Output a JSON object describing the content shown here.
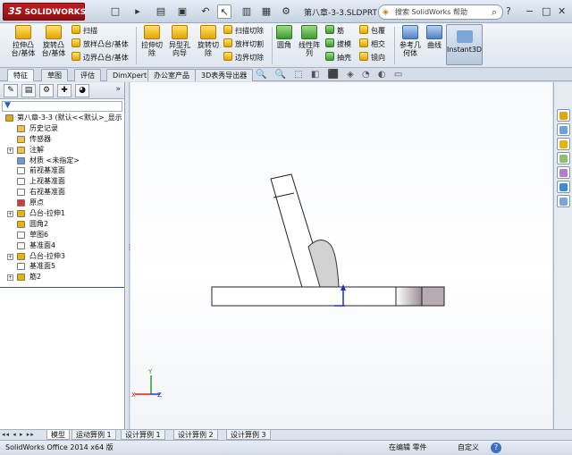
{
  "app": {
    "logo_text": "SOLIDWORKS",
    "logo_mark": "3S",
    "document_title": "第八章-3-3.SLDPRT",
    "search_placeholder": "搜索 SolidWorks 帮助",
    "help_glyph": "?",
    "window_controls": [
      "−",
      "□",
      "✕"
    ],
    "quick_access": [
      "□",
      "▸",
      "▤",
      "▣",
      "↶",
      "↖",
      "▥",
      "▦",
      "⚙"
    ]
  },
  "ribbon": {
    "features_group1": [
      {
        "label": "拉伸凸\n台/基体",
        "icon": "extrude-boss-icon"
      },
      {
        "label": "旋转凸\n台/基体",
        "icon": "revolve-boss-icon"
      }
    ],
    "features_group1_small": [
      {
        "label": "扫描",
        "icon": "sweep-icon"
      },
      {
        "label": "放样凸台/基体",
        "icon": "loft-icon"
      },
      {
        "label": "边界凸台/基体",
        "icon": "boundary-boss-icon"
      }
    ],
    "features_group2": [
      {
        "label": "拉伸切\n除",
        "icon": "extrude-cut-icon"
      },
      {
        "label": "异型孔\n向导",
        "icon": "hole-wizard-icon"
      },
      {
        "label": "旋转切\n除",
        "icon": "revolve-cut-icon"
      }
    ],
    "features_group2_small": [
      {
        "label": "扫描切除",
        "icon": "swept-cut-icon"
      },
      {
        "label": "放样切割",
        "icon": "lofted-cut-icon"
      },
      {
        "label": "边界切除",
        "icon": "boundary-cut-icon"
      }
    ],
    "features_group3": [
      {
        "label": "圆角",
        "icon": "fillet-icon"
      },
      {
        "label": "线性阵\n列",
        "icon": "linear-pattern-icon"
      }
    ],
    "features_group3_small": [
      {
        "label": "筋",
        "icon": "rib-icon"
      },
      {
        "label": "拔模",
        "icon": "draft-icon"
      },
      {
        "label": "抽壳",
        "icon": "shell-icon"
      },
      {
        "label": "包覆",
        "icon": "wrap-icon"
      },
      {
        "label": "相交",
        "icon": "intersect-icon"
      },
      {
        "label": "镜向",
        "icon": "mirror-icon"
      }
    ],
    "features_group4": [
      {
        "label": "参考几\n何体",
        "icon": "reference-geometry-icon"
      },
      {
        "label": "曲线",
        "icon": "curves-icon"
      }
    ],
    "instant3d": "Instant3D"
  },
  "tabs": [
    {
      "label": "特征",
      "active": true
    },
    {
      "label": "草图",
      "active": false
    },
    {
      "label": "评估",
      "active": false
    },
    {
      "label": "DimXpert",
      "active": false
    },
    {
      "label": "办公室产品",
      "active": false
    },
    {
      "label": "3D表秀导出器",
      "active": false
    }
  ],
  "heads_up_toolbar": "🔍 🔍 ⬚ ◧ ⬛ ◈ ◔ ◐ ▭",
  "panel": {
    "more_glyph": "»",
    "tab_glyphs": [
      "✎",
      "▤",
      "⚙",
      "✚",
      "◕"
    ],
    "filter_glyph": "▼"
  },
  "feature_tree": [
    {
      "label": "第八章-3-3  (默认<<默认>_显示",
      "icon": "part-icon",
      "color": "#e0a800",
      "root": true,
      "expander": ""
    },
    {
      "label": "历史记录",
      "icon": "history-icon",
      "color": "#f0c24a",
      "expander": ""
    },
    {
      "label": "传感器",
      "icon": "sensors-icon",
      "color": "#f0c24a",
      "expander": ""
    },
    {
      "label": "注解",
      "icon": "annotations-icon",
      "color": "#f0c24a",
      "expander": "+"
    },
    {
      "label": "材质 <未指定>",
      "icon": "material-icon",
      "color": "#6a9ad6",
      "expander": ""
    },
    {
      "label": "前视基准面",
      "icon": "plane-icon",
      "color": "#ffffff",
      "expander": ""
    },
    {
      "label": "上视基准面",
      "icon": "plane-icon",
      "color": "#ffffff",
      "expander": ""
    },
    {
      "label": "右视基准面",
      "icon": "plane-icon",
      "color": "#ffffff",
      "expander": ""
    },
    {
      "label": "原点",
      "icon": "origin-icon",
      "color": "#d23a3a",
      "expander": ""
    },
    {
      "label": "凸台-拉伸1",
      "icon": "extrude-feature-icon",
      "color": "#e8b400",
      "expander": "+"
    },
    {
      "label": "圆角2",
      "icon": "fillet-feature-icon",
      "color": "#e8b400",
      "expander": ""
    },
    {
      "label": "草图6",
      "icon": "sketch-icon",
      "color": "#ffffff",
      "expander": ""
    },
    {
      "label": "基准面4",
      "icon": "plane-icon",
      "color": "#ffffff",
      "expander": ""
    },
    {
      "label": "凸台-拉伸3",
      "icon": "extrude-feature-icon",
      "color": "#e8b400",
      "expander": "+"
    },
    {
      "label": "基准面5",
      "icon": "plane-icon",
      "color": "#ffffff",
      "expander": ""
    },
    {
      "label": "筋2",
      "icon": "rib-feature-icon",
      "color": "#e8b400",
      "expander": "+"
    }
  ],
  "triad": {
    "x": "X",
    "y": "Y",
    "z": "Z"
  },
  "task_pane": [
    {
      "icon": "solidworks-resources-icon",
      "color": "#e0a800"
    },
    {
      "icon": "design-library-icon",
      "color": "#6aa3dc"
    },
    {
      "icon": "file-explorer-icon",
      "color": "#e5b400"
    },
    {
      "icon": "search-view-icon",
      "color": "#8fbf6a"
    },
    {
      "icon": "view-palette-icon",
      "color": "#b07bd0"
    },
    {
      "icon": "appearances-icon",
      "color": "#3a8ad6"
    },
    {
      "icon": "custom-properties-icon",
      "color": "#7ba7d8"
    }
  ],
  "bottom_tabs": {
    "nav": "◂◂ ◂ ▸ ▸▸",
    "items": [
      {
        "label": "模型",
        "active": true
      },
      {
        "label": "运动算例 1",
        "active": false
      },
      {
        "label": "设计算例 1",
        "active": false
      },
      {
        "label": "设计算例 2",
        "active": false
      },
      {
        "label": "设计算例 3",
        "active": false
      }
    ]
  },
  "status": {
    "left": "SolidWorks Office 2014 x64 版",
    "mid": "在编辑 零件",
    "right": "自定义",
    "help": "?"
  }
}
